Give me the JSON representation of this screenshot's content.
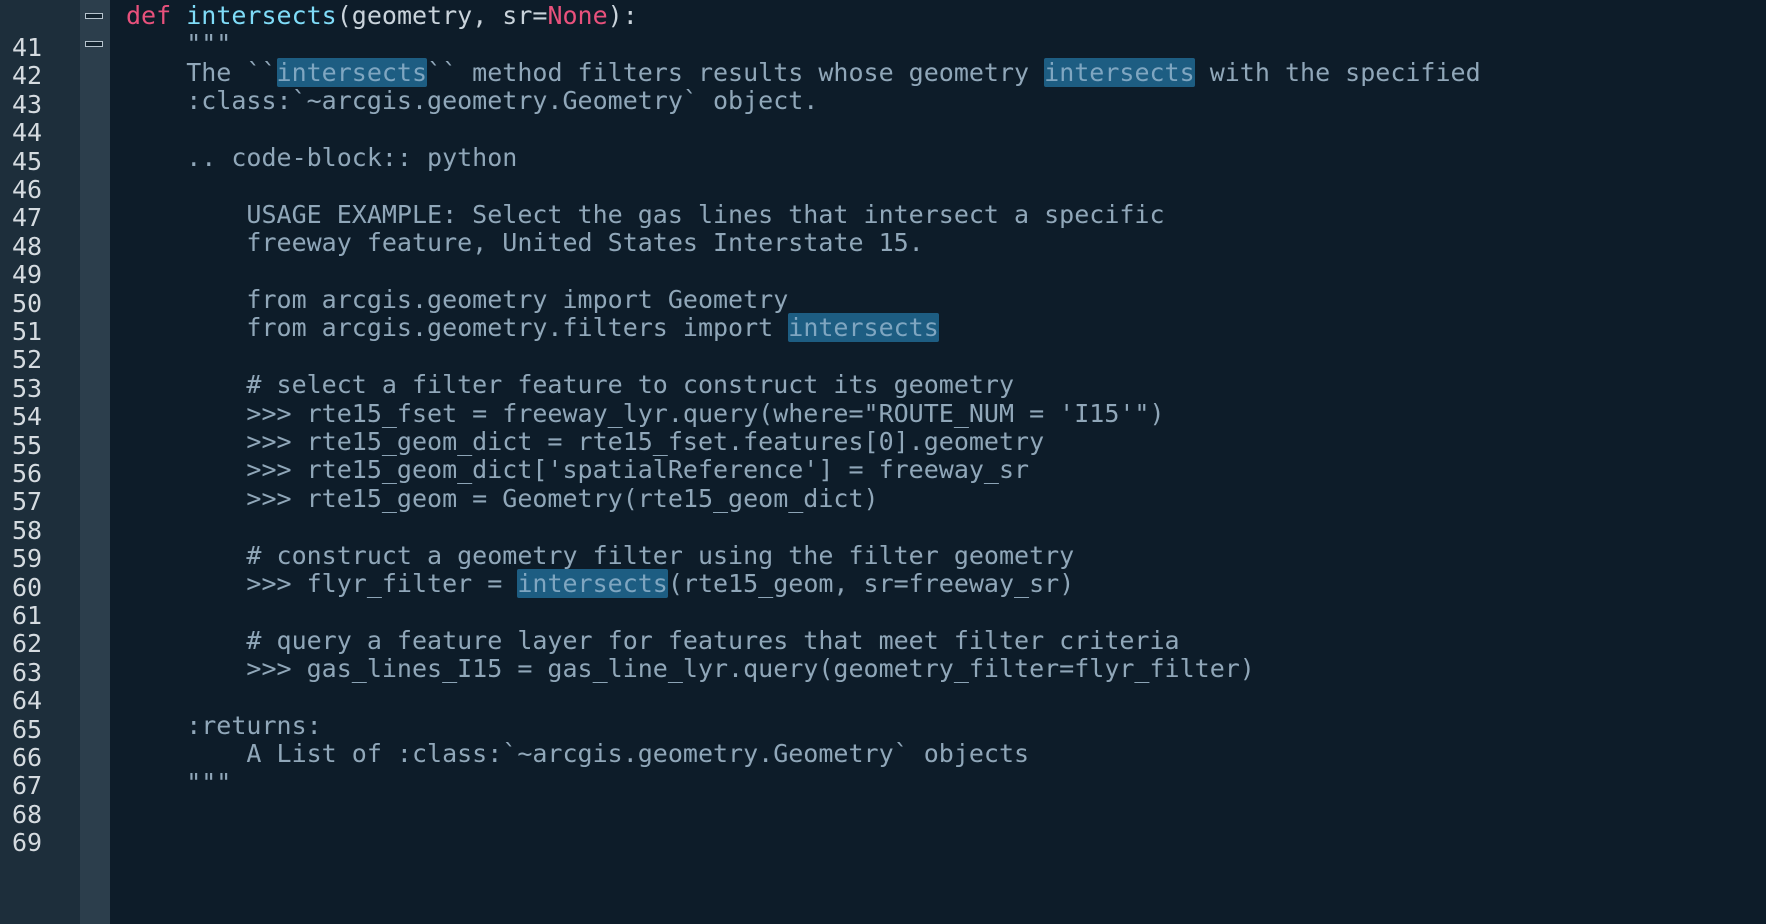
{
  "editor": {
    "language": "python",
    "theme_colors": {
      "background": "#0d1c29",
      "gutter": "#1d2e3b",
      "keyword": "#e8517c",
      "function": "#7fdcf8",
      "docstring": "#90a7b9",
      "highlight": "#1d5d82"
    },
    "highlighted_term": "intersects",
    "line_numbers": [
      "41",
      "42",
      "43",
      "44",
      "45",
      "46",
      "47",
      "48",
      "49",
      "50",
      "51",
      "52",
      "53",
      "54",
      "55",
      "56",
      "57",
      "58",
      "59",
      "60",
      "61",
      "62",
      "63",
      "64",
      "65",
      "66",
      "67",
      "68",
      "69"
    ],
    "lines": {
      "l41": {
        "kw": "def",
        "fn": "intersects",
        "rest": "(geometry, sr=",
        "none": "None",
        "end": "):"
      },
      "l42": "    \"\"\"",
      "l43": {
        "a": "    The ``",
        "b": "intersects",
        "c": "`` method filters results whose geometry ",
        "d": "intersects",
        "e": " with the specified"
      },
      "l44": "    :class:`~arcgis.geometry.Geometry` object.",
      "l45": "",
      "l46": "    .. code-block:: python",
      "l47": "",
      "l48": "        USAGE EXAMPLE: Select the gas lines that intersect a specific",
      "l49": "        freeway feature, United States Interstate 15.",
      "l50": "",
      "l51": "        from arcgis.geometry import Geometry",
      "l52": {
        "a": "        from arcgis.geometry.filters import ",
        "b": "intersects"
      },
      "l53": "",
      "l54": "        # select a filter feature to construct its geometry",
      "l55": "        >>> rte15_fset = freeway_lyr.query(where=\"ROUTE_NUM = 'I15'\")",
      "l56": "        >>> rte15_geom_dict = rte15_fset.features[0].geometry",
      "l57": "        >>> rte15_geom_dict['spatialReference'] = freeway_sr",
      "l58": "        >>> rte15_geom = Geometry(rte15_geom_dict)",
      "l59": "",
      "l60": "        # construct a geometry filter using the filter geometry",
      "l61": {
        "a": "        >>> flyr_filter = ",
        "b": "intersects",
        "c": "(rte15_geom, sr=freeway_sr)"
      },
      "l62": "",
      "l63": "        # query a feature layer for features that meet filter criteria",
      "l64": "        >>> gas_lines_I15 = gas_line_lyr.query(geometry_filter=flyr_filter)",
      "l65": "",
      "l66": "    :returns:",
      "l67": "        A List of :class:`~arcgis.geometry.Geometry` objects",
      "l68": "    \"\"\"",
      "l69": ""
    }
  }
}
